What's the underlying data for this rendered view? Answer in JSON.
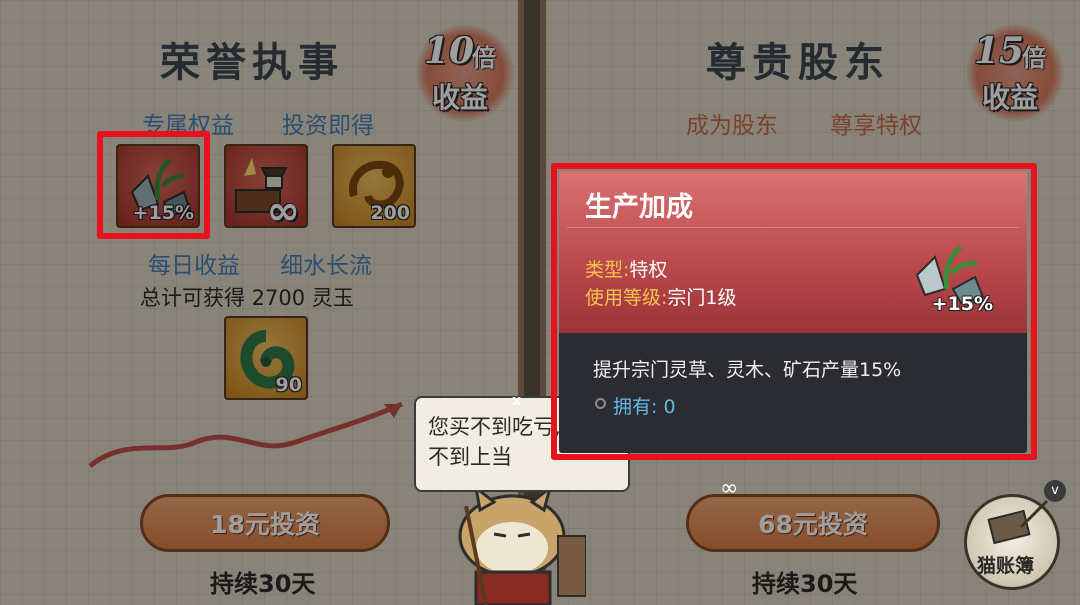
{
  "left_panel": {
    "title": "荣誉执事",
    "multiplier": {
      "number": "10",
      "unit": "倍",
      "label": "收益"
    },
    "section_rights": "专属权益",
    "section_invest": "投资即得",
    "items": [
      {
        "icon": "herb-crystal-icon",
        "count": "+15%"
      },
      {
        "icon": "sect-building-icon",
        "count": "∞"
      },
      {
        "icon": "gold-dragon-icon",
        "count": "200"
      }
    ],
    "section_daily": "每日收益",
    "section_flow": "细水长流",
    "total_text": "总计可获得 2700 灵玉",
    "daily_item": {
      "icon": "jade-icon",
      "count": "90"
    },
    "invest_button": "18元投资",
    "duration": "持续30天"
  },
  "right_panel": {
    "title": "尊贵股东",
    "multiplier": {
      "number": "15",
      "unit": "倍",
      "label": "收益"
    },
    "section_rights": "成为股东",
    "section_privilege": "尊享特权",
    "invest_button": "68元投资",
    "duration": "持续30天",
    "ledger_label": "猫账簿"
  },
  "speech_bubble": {
    "text_line1": "您买不到吃亏,买",
    "text_line2": "不到上当",
    "close": "x"
  },
  "tooltip": {
    "title": "生产加成",
    "type_label": "类型:",
    "type_value": "特权",
    "level_label": "使用等级:",
    "level_value": "宗门1级",
    "item_icon": "herb-crystal-icon",
    "item_count": "+15%",
    "description": "提升宗门灵草、灵木、矿石产量15%",
    "owned_label": "拥有:",
    "owned_value": "0"
  },
  "badge": "v",
  "colors": {
    "highlight": "#e8121e",
    "tooltip_red": "#b9474a",
    "tooltip_dark": "#2b2c31"
  }
}
